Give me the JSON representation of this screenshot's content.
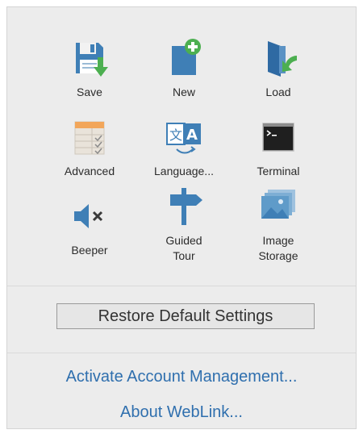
{
  "tiles": [
    {
      "label": "Save",
      "icon": "save-icon"
    },
    {
      "label": "New",
      "icon": "new-icon"
    },
    {
      "label": "Load",
      "icon": "load-icon"
    },
    {
      "label": "Advanced",
      "icon": "advanced-icon"
    },
    {
      "label": "Language...",
      "icon": "language-icon"
    },
    {
      "label": "Terminal",
      "icon": "terminal-icon"
    },
    {
      "label": "Beeper",
      "icon": "beeper-icon"
    },
    {
      "label": "Guided\nTour",
      "icon": "guided-tour-icon"
    },
    {
      "label": "Image\nStorage",
      "icon": "image-storage-icon"
    }
  ],
  "restore": {
    "label": "Restore Default Settings"
  },
  "links": {
    "activate": "Activate Account Management...",
    "about": "About WebLink..."
  },
  "colors": {
    "icon_blue": "#3f7fb6",
    "accent_green": "#4caf50",
    "link_blue": "#2f6fae",
    "panel_bg": "#ececec"
  }
}
